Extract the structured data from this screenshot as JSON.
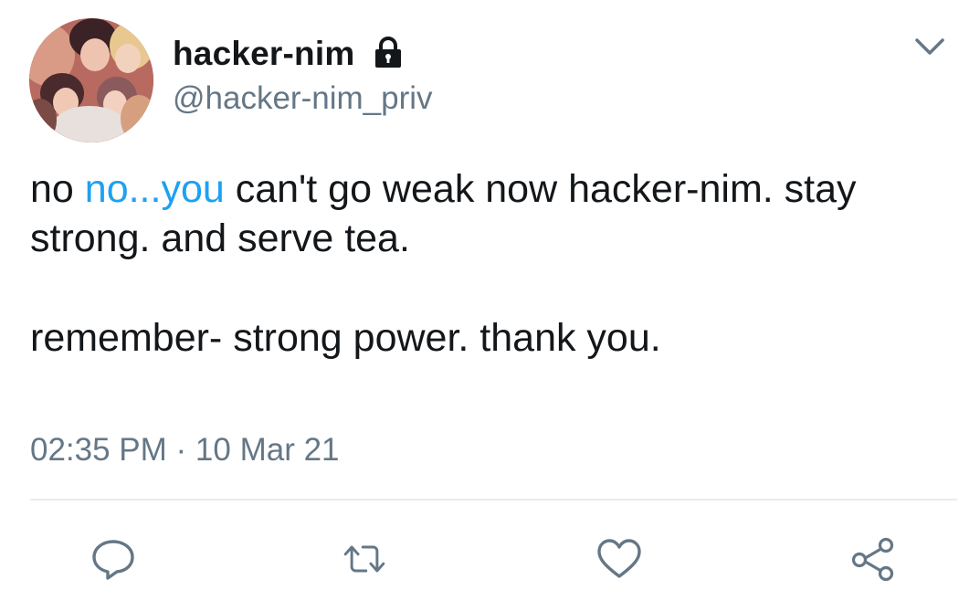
{
  "author": {
    "display_name": "hacker-nim",
    "handle": "@hacker-nim_priv",
    "protected": true
  },
  "tweet": {
    "line1_pre": "no ",
    "line1_mention": "no...you",
    "line1_post": " can't go weak now hacker-nim. stay strong. and serve tea.",
    "line2": "remember- strong power. thank you.",
    "timestamp": "02:35 PM · 10 Mar 21"
  },
  "icons": {
    "lock": "lock-icon",
    "menu": "chevron-down-icon",
    "reply": "reply-icon",
    "retweet": "retweet-icon",
    "like": "heart-icon",
    "share": "share-icon"
  },
  "colors": {
    "text": "#14171a",
    "secondary": "#657786",
    "link": "#1da1f2",
    "divider": "#e6ecf0"
  }
}
